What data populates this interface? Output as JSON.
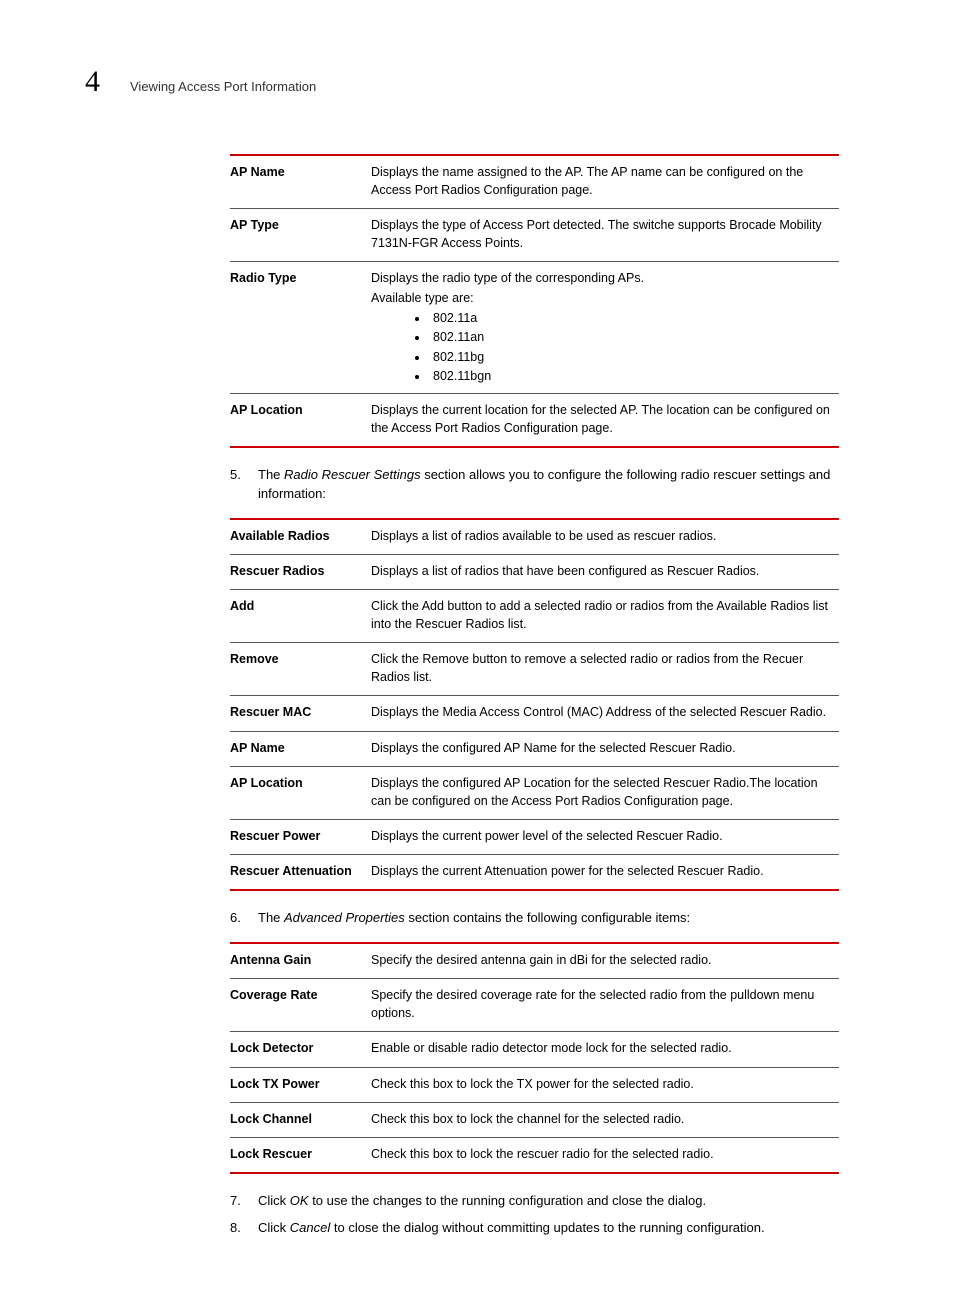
{
  "header": {
    "chapter_number": "4",
    "section_title": "Viewing Access Port Information"
  },
  "table1": {
    "rows": [
      {
        "term": "AP Name",
        "desc_html": "<p>Displays the name assigned to the AP. The AP name can be configured on the Access Port Radios Configuration page.</p>"
      },
      {
        "term": "AP Type",
        "desc_html": "<p>Displays the type of Access Port detected. The switche supports Brocade Mobility 7131N-FGR Access Points.</p>"
      },
      {
        "term": "Radio Type",
        "desc_html": "<p>Displays the radio type of the corresponding APs.</p><p>Available type are:</p>",
        "bullets": [
          "802.11a",
          "802.11an",
          "802.11bg",
          "802.11bgn"
        ]
      },
      {
        "term": "AP Location",
        "desc_html": "<p>Displays the current location for the selected AP. The location can be configured on the Access Port Radios Configuration page.</p>"
      }
    ]
  },
  "steps_a": [
    {
      "num": "5.",
      "pre": "The ",
      "em": "Radio Rescuer Settings",
      "post": " section allows you to configure the following radio rescuer settings and information:"
    }
  ],
  "table2": {
    "rows": [
      {
        "term": "Available Radios",
        "desc_html": "<p>Displays a list of radios available to be used as rescuer radios.</p>"
      },
      {
        "term": "Rescuer Radios",
        "desc_html": "<p>Displays a list of radios that have been configured as Rescuer Radios.</p>"
      },
      {
        "term": "Add",
        "desc_html": "<p>Click the Add button to add a selected radio or radios from the Available Radios list into the Rescuer Radios list.</p>"
      },
      {
        "term": "Remove",
        "desc_html": "<p>Click the Remove button to remove a selected radio or radios from the Recuer Radios list.</p>"
      },
      {
        "term": "Rescuer MAC",
        "desc_html": "<p>Displays the Media Access Control (MAC) Address of the selected Rescuer Radio.</p>"
      },
      {
        "term": "AP Name",
        "desc_html": "<p>Displays the configured AP Name for the selected Rescuer Radio.</p>"
      },
      {
        "term": "AP Location",
        "desc_html": "<p>Displays the configured AP Location for the selected Rescuer Radio.The location can be configured on the Access Port Radios Configuration page.</p>"
      },
      {
        "term": "Rescuer Power",
        "desc_html": "<p>Displays the current power level of the selected Rescuer Radio.</p>"
      },
      {
        "term": "Rescuer Attenuation",
        "desc_html": "<p>Displays the current Attenuation power for the selected Rescuer Radio.</p>"
      }
    ]
  },
  "steps_b": [
    {
      "num": "6.",
      "pre": "The ",
      "em": "Advanced Properties",
      "post": " section contains the following configurable items:"
    }
  ],
  "table3": {
    "rows": [
      {
        "term": "Antenna Gain",
        "desc_html": "<p>Specify the desired antenna gain in dBi for the selected radio.</p>"
      },
      {
        "term": "Coverage Rate",
        "desc_html": "<p>Specify the desired coverage rate for the selected radio from the pulldown menu options.</p>"
      },
      {
        "term": "Lock Detector",
        "desc_html": "<p>Enable or disable radio detector mode lock for the selected radio.</p>"
      },
      {
        "term": "Lock TX Power",
        "desc_html": "<p>Check this box to lock the TX power for the selected radio.</p>"
      },
      {
        "term": "Lock Channel",
        "desc_html": "<p>Check this box to lock the channel for the selected radio.</p>"
      },
      {
        "term": "Lock Rescuer",
        "desc_html": "<p>Check this box to lock the rescuer radio for the selected radio.</p>"
      }
    ]
  },
  "steps_c": [
    {
      "num": "7.",
      "pre": "Click ",
      "em": "OK",
      "post": " to use the changes to the running configuration and close the dialog."
    },
    {
      "num": "8.",
      "pre": "Click ",
      "em": "Cancel",
      "post": " to close the dialog without committing updates to the running configuration."
    }
  ]
}
